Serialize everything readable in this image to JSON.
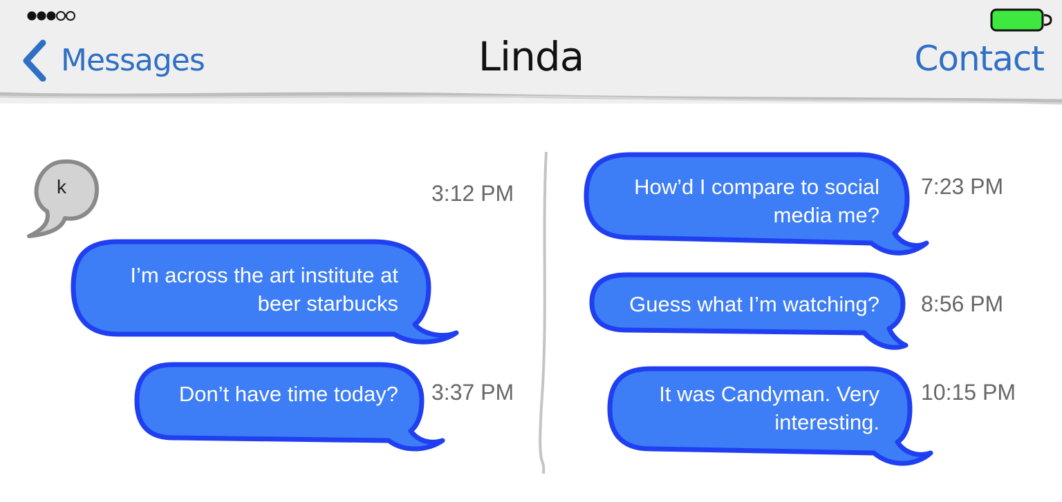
{
  "status_bar": {
    "signal_icon": "signal-dots-icon",
    "battery_icon": "battery-full-icon",
    "battery_color": "#3ee83e"
  },
  "header": {
    "back_label": "Messages",
    "title": "Linda",
    "contact_label": "Contact",
    "accent_color": "#2f6fc4"
  },
  "conversation": {
    "avatar_letter": "k",
    "bubble_color": "#3d7df5",
    "bubble_border_color": "#1f3ff0",
    "left_column": [
      {
        "text": "I’m across the art institute at beer starbucks",
        "time": "3:12 PM"
      },
      {
        "text": "Don’t have time today?",
        "time": "3:37 PM"
      }
    ],
    "right_column": [
      {
        "text": "How’d I compare to social media me?",
        "time": "7:23 PM"
      },
      {
        "text": "Guess what I’m watching?",
        "time": "8:56 PM"
      },
      {
        "text": "It was Candyman. Very interesting.",
        "time": "10:15 PM"
      }
    ]
  }
}
